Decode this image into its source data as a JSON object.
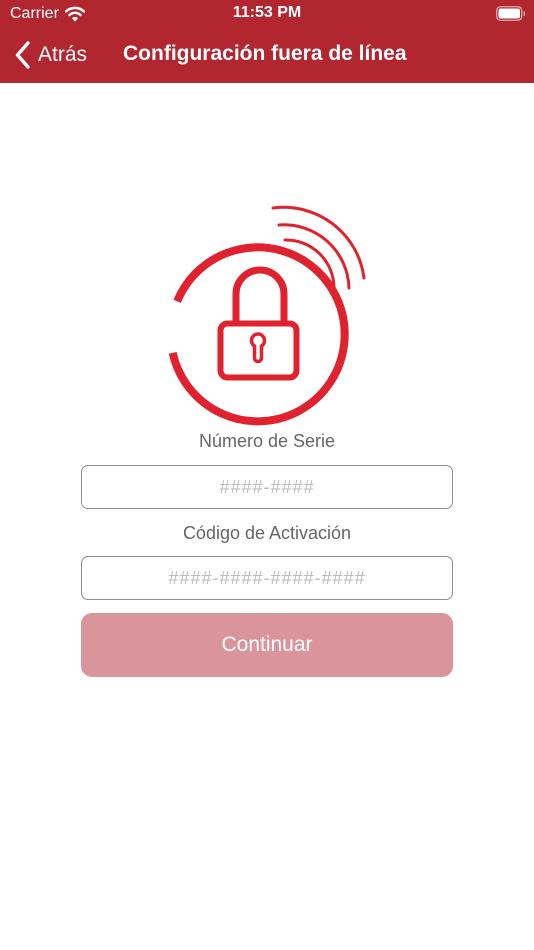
{
  "status_bar": {
    "carrier": "Carrier",
    "time": "11:53 PM",
    "wifi_icon": "wifi-icon",
    "battery_icon": "battery-icon"
  },
  "nav": {
    "back_label": "Atrás",
    "back_icon": "chevron-left-icon",
    "title": "Configuración fuera de línea"
  },
  "form": {
    "serial_label": "Número de Serie",
    "serial_value": "",
    "serial_placeholder": "####-####",
    "activation_label": "Código de Activación",
    "activation_value": "",
    "activation_placeholder": "####-####-####-####",
    "continue_label": "Continuar"
  },
  "logo_icon": "wireless-lock-icon",
  "colors": {
    "brand": "#b2262f",
    "logo_red": "#e0222e",
    "button_disabled": "#d9959b",
    "label_gray": "#666666",
    "border_gray": "#8c8c8c",
    "placeholder_gray": "#bbbbbb"
  }
}
